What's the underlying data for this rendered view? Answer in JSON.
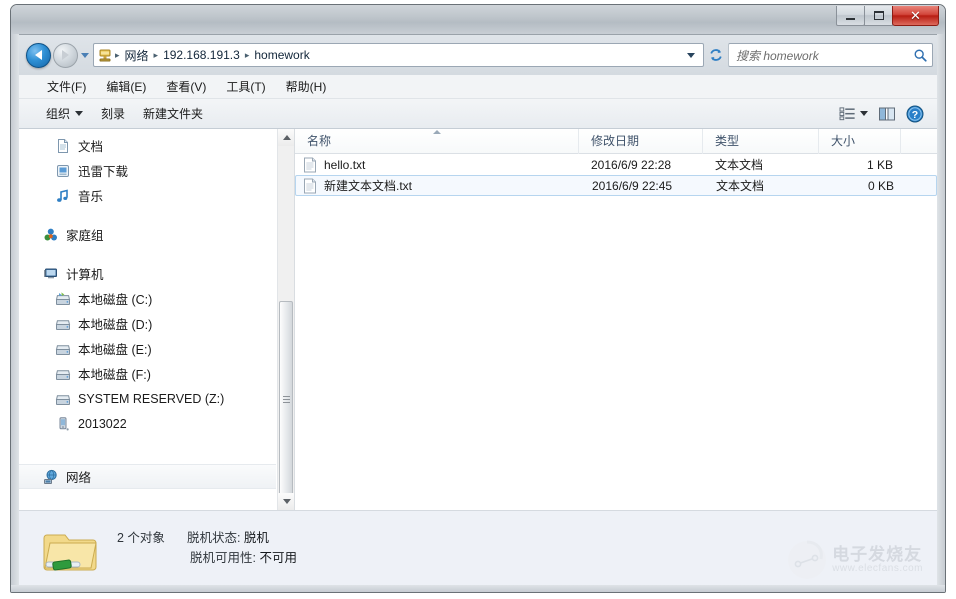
{
  "window": {
    "controls": {
      "minimize_label": "最小化",
      "maximize_label": "最大化",
      "close_label": "✕"
    }
  },
  "navbar": {
    "back_label": "后退",
    "forward_label": "前进",
    "recent_pages_label": "最近浏览的页面",
    "breadcrumbs": [
      {
        "label": "网络"
      },
      {
        "label": "192.168.191.3"
      },
      {
        "label": "homework"
      }
    ],
    "separator": "▸",
    "refresh_label": "刷新",
    "search": {
      "placeholder": "搜索 homework",
      "value": ""
    }
  },
  "menubar": {
    "items": [
      {
        "label": "文件(F)"
      },
      {
        "label": "编辑(E)"
      },
      {
        "label": "查看(V)"
      },
      {
        "label": "工具(T)"
      },
      {
        "label": "帮助(H)"
      }
    ]
  },
  "toolbar": {
    "organize_label": "组织",
    "burn_label": "刻录",
    "new_folder_label": "新建文件夹",
    "view_label": "更改您的视图",
    "preview_pane_label": "显示预览窗格",
    "help_label": "获取帮助"
  },
  "sidebar": {
    "groups": [
      {
        "items": [
          {
            "label": "文档",
            "icon": "document-icon",
            "indent": true
          },
          {
            "label": "迅雷下载",
            "icon": "download-icon",
            "indent": true
          },
          {
            "label": "音乐",
            "icon": "music-icon",
            "indent": true
          }
        ]
      },
      {
        "items": [
          {
            "label": "家庭组",
            "icon": "homegroup-icon",
            "indent": false
          }
        ]
      },
      {
        "items": [
          {
            "label": "计算机",
            "icon": "computer-icon",
            "indent": false
          },
          {
            "label": "本地磁盘 (C:)",
            "icon": "system-drive-icon",
            "indent": true
          },
          {
            "label": "本地磁盘 (D:)",
            "icon": "drive-icon",
            "indent": true
          },
          {
            "label": "本地磁盘 (E:)",
            "icon": "drive-icon",
            "indent": true
          },
          {
            "label": "本地磁盘 (F:)",
            "icon": "drive-icon",
            "indent": true
          },
          {
            "label": "SYSTEM RESERVED (Z:)",
            "icon": "drive-icon",
            "indent": true
          },
          {
            "label": "2013022",
            "icon": "portable-device-icon",
            "indent": true
          }
        ]
      },
      {
        "items": [
          {
            "label": "网络",
            "icon": "network-icon",
            "indent": false,
            "highlight": true
          }
        ]
      }
    ]
  },
  "filelist": {
    "columns": [
      {
        "label": "名称",
        "sorted": "asc"
      },
      {
        "label": "修改日期",
        "sorted": ""
      },
      {
        "label": "类型",
        "sorted": ""
      },
      {
        "label": "大小",
        "sorted": ""
      }
    ],
    "rows": [
      {
        "name": "hello.txt",
        "modified": "2016/6/9 22:28",
        "type": "文本文档",
        "size": "1 KB",
        "icon": "text-file-icon",
        "selected": false
      },
      {
        "name": "新建文本文档.txt",
        "modified": "2016/6/9 22:45",
        "type": "文本文档",
        "size": "0 KB",
        "icon": "text-file-icon",
        "selected": true
      }
    ]
  },
  "statusbar": {
    "item_count": "2 个对象",
    "offline_status_label": "脱机状态:",
    "offline_status_value": "脱机",
    "offline_availability_label": "脱机可用性:",
    "offline_availability_value": "不可用",
    "icon": "shared-folder-icon"
  },
  "watermark": {
    "name": "电子发烧友",
    "url": "www.elecfans.com"
  },
  "colors": {
    "accent_blue": "#2d8fd4",
    "close_red": "#c02e22",
    "selection_border": "#b6d5ef",
    "selection_fill": "#f5f9fe",
    "column_header_text": "#40536b",
    "status_bg": "#eef1f7"
  }
}
